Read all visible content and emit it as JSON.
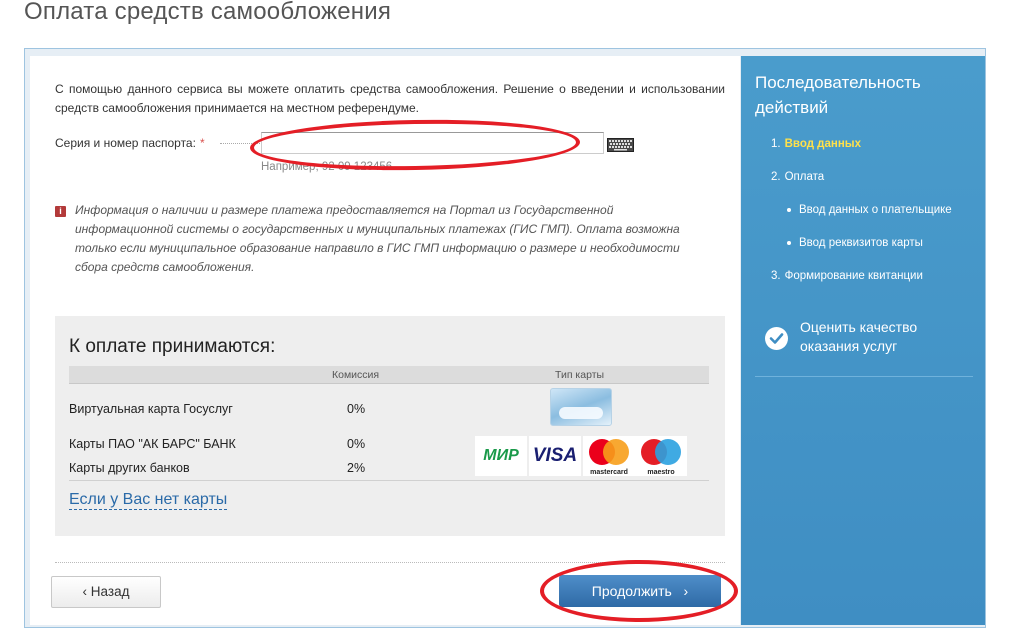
{
  "page": {
    "title": "Оплата средств самообложения"
  },
  "form": {
    "intro": "С помощью данного сервиса вы можете оплатить средства самообложения. Решение о введении и использовании средств самообложения принимается на местном референдуме.",
    "passport_label": "Серия и номер паспорта:",
    "required_mark": "*",
    "passport_value": "",
    "passport_hint": "Например, 92 09 123456",
    "info_icon": "i",
    "info_text": "Информация о наличии и размере платежа предоставляется на Портал из Государственной информационной системы о государственных и муниципальных платежах (ГИС ГМП). Оплата возможна только если муниципальное образование направило в ГИС ГМП информацию о размере и необходимости сбора средств самообложения."
  },
  "payment": {
    "title": "К оплате принимаются:",
    "col_commission": "Комиссия",
    "col_card_type": "Тип карты",
    "rows": [
      {
        "label": "Виртуальная карта Госуслуг",
        "commission": "0%"
      },
      {
        "label": "Карты ПАО \"АК БАРС\" БАНК",
        "commission": "0%"
      },
      {
        "label": "Карты других банков",
        "commission": "2%"
      }
    ],
    "logos": {
      "mir": "МИР",
      "visa": "VISA",
      "mastercard": "mastercard",
      "maestro": "maestro"
    },
    "no_card_link": "Если у Вас нет карты"
  },
  "buttons": {
    "back": "Назад",
    "back_icon": "‹",
    "next": "Продолжить",
    "next_icon": "›"
  },
  "sidebar": {
    "title": "Последовательность действий",
    "steps": [
      {
        "num": "1.",
        "label": "Ввод данных",
        "active": true
      },
      {
        "num": "2.",
        "label": "Оплата"
      },
      {
        "num": "",
        "label": "Ввод данных о плательщике",
        "sub": true
      },
      {
        "num": "",
        "label": "Ввод реквизитов карты",
        "sub": true
      },
      {
        "num": "3.",
        "label": "Формирование квитанции"
      }
    ],
    "rate": "Оценить качество оказания услуг"
  },
  "colors": {
    "accent": "#3f8ec3",
    "active_step": "#ffe14a",
    "annotation": "#e41e26",
    "button": "#2f6aa6"
  }
}
